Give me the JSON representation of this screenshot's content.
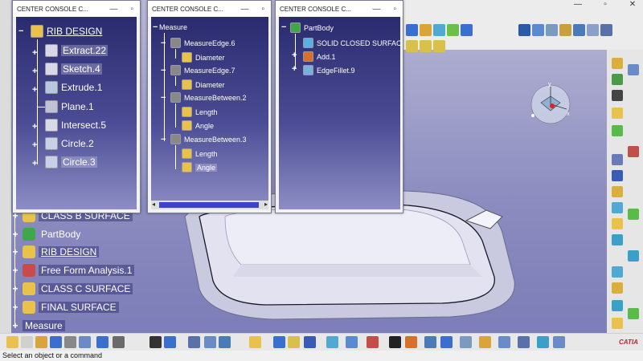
{
  "status": {
    "text": "Select an object or a command"
  },
  "window_controls": {
    "minimize": "—",
    "maximize": "▫",
    "close": "✕"
  },
  "background_tree": {
    "items": [
      {
        "label": "CLASS B SURFACE",
        "underlined": false
      },
      {
        "label": "PartBody",
        "underlined": false
      },
      {
        "label": "RIB DESIGN",
        "underlined": true
      },
      {
        "label": "Free Form Analysis.1",
        "underlined": false
      },
      {
        "label": "CLASS C SURFACE",
        "underlined": false
      },
      {
        "label": "FINAL SURFACE",
        "underlined": false
      },
      {
        "label": "Measure",
        "underlined": false
      }
    ]
  },
  "windows": [
    {
      "title": "CENTER CONSOLE C...",
      "tree": {
        "root": "RIB DESIGN",
        "items": [
          "Extract.22",
          "Sketch.4",
          "Extrude.1",
          "Plane.1",
          "Intersect.5",
          "Circle.2",
          "Circle.3"
        ]
      }
    },
    {
      "title": "CENTER CONSOLE C...",
      "tree": {
        "root": "Measure",
        "groups": [
          {
            "label": "MeasureEdge.6",
            "children": [
              "Diameter"
            ]
          },
          {
            "label": "MeasureEdge.7",
            "children": [
              "Diameter"
            ]
          },
          {
            "label": "MeasureBetween.2",
            "children": [
              "Length",
              "Angle"
            ]
          },
          {
            "label": "MeasureBetween.3",
            "children": [
              "Length",
              "Angle"
            ]
          }
        ]
      }
    },
    {
      "title": "CENTER CONSOLE C...",
      "tree": {
        "root": "PartBody",
        "items": [
          "SOLID CLOSED SURFACE",
          "Add.1",
          "EdgeFillet.9"
        ]
      }
    }
  ],
  "compass": {
    "x": "x",
    "y": "y",
    "z": "z"
  },
  "logo": {
    "text": "CATIA"
  },
  "colors": {
    "tree_bg_top": "#2a2b6e",
    "tree_bg_bottom": "#8d8dc4",
    "viewport": "#8c8cc0",
    "scroll_thumb": "#3944c8"
  }
}
